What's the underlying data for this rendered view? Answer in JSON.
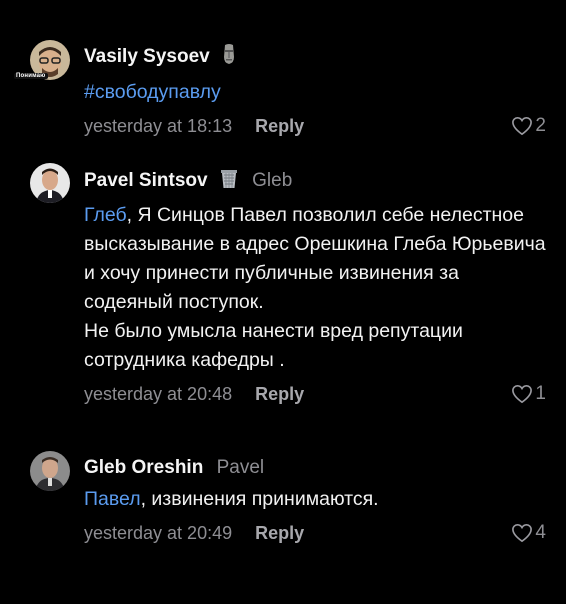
{
  "comments": [
    {
      "author": "Vasily Sysoev",
      "badge": "moai-icon",
      "avatar_tag": "Понимаю",
      "hashtag": "#свободупавлу",
      "time": "yesterday at 18:13",
      "reply_label": "Reply",
      "likes": "2"
    },
    {
      "author": "Pavel Sintsov",
      "badge": "trash-bin-icon",
      "reply_to": "Gleb",
      "mention": "Глеб",
      "text": ", Я Синцов Павел позволил себе нелестное высказывание в адрес Орешкина Глеба Юрьевича и хочу принести публичные извинения за содеяный поступок.\nНе было умысла нанести вред репутации сотрудника кафедры .",
      "time": "yesterday at 20:48",
      "reply_label": "Reply",
      "likes": "1"
    },
    {
      "author": "Gleb Oreshin",
      "reply_to": "Pavel",
      "mention": "Павел",
      "text": ", извинения принимаются.",
      "time": "yesterday at 20:49",
      "reply_label": "Reply",
      "likes": "4"
    }
  ]
}
